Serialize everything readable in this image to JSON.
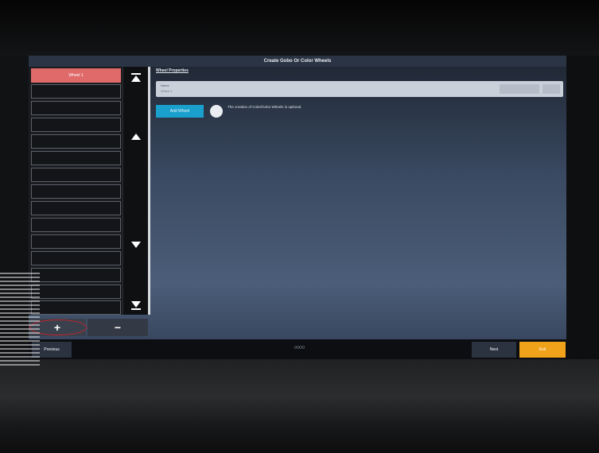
{
  "window": {
    "title": "Create Gobo Or Color Wheels"
  },
  "wheel_list": {
    "items": [
      {
        "label": "Wheel 1",
        "selected": true
      },
      {
        "label": ""
      },
      {
        "label": ""
      },
      {
        "label": ""
      },
      {
        "label": ""
      },
      {
        "label": ""
      },
      {
        "label": ""
      },
      {
        "label": ""
      },
      {
        "label": ""
      },
      {
        "label": ""
      },
      {
        "label": ""
      },
      {
        "label": ""
      },
      {
        "label": ""
      },
      {
        "label": ""
      },
      {
        "label": ""
      }
    ],
    "scroll_icons": [
      "scroll-to-top-icon",
      "scroll-up-icon",
      "scroll-down-icon",
      "scroll-to-bottom-icon"
    ]
  },
  "list_actions": {
    "add": "+",
    "remove": "−"
  },
  "properties": {
    "header": "Wheel Properties",
    "name_label": "Name",
    "name_value": "Wheel 1",
    "add_wheel": "Add Wheel",
    "hint": "The creation of Color/Gobo Wheels is optional."
  },
  "nav": {
    "previous": "Previous",
    "page_dots": "○○○○",
    "next": "Next",
    "exit": "Exit"
  },
  "colors": {
    "selected_item": "#e06a6a",
    "add_wheel": "#1aa0cc",
    "exit": "#f0a21a",
    "highlight_ring": "#c0242c"
  }
}
